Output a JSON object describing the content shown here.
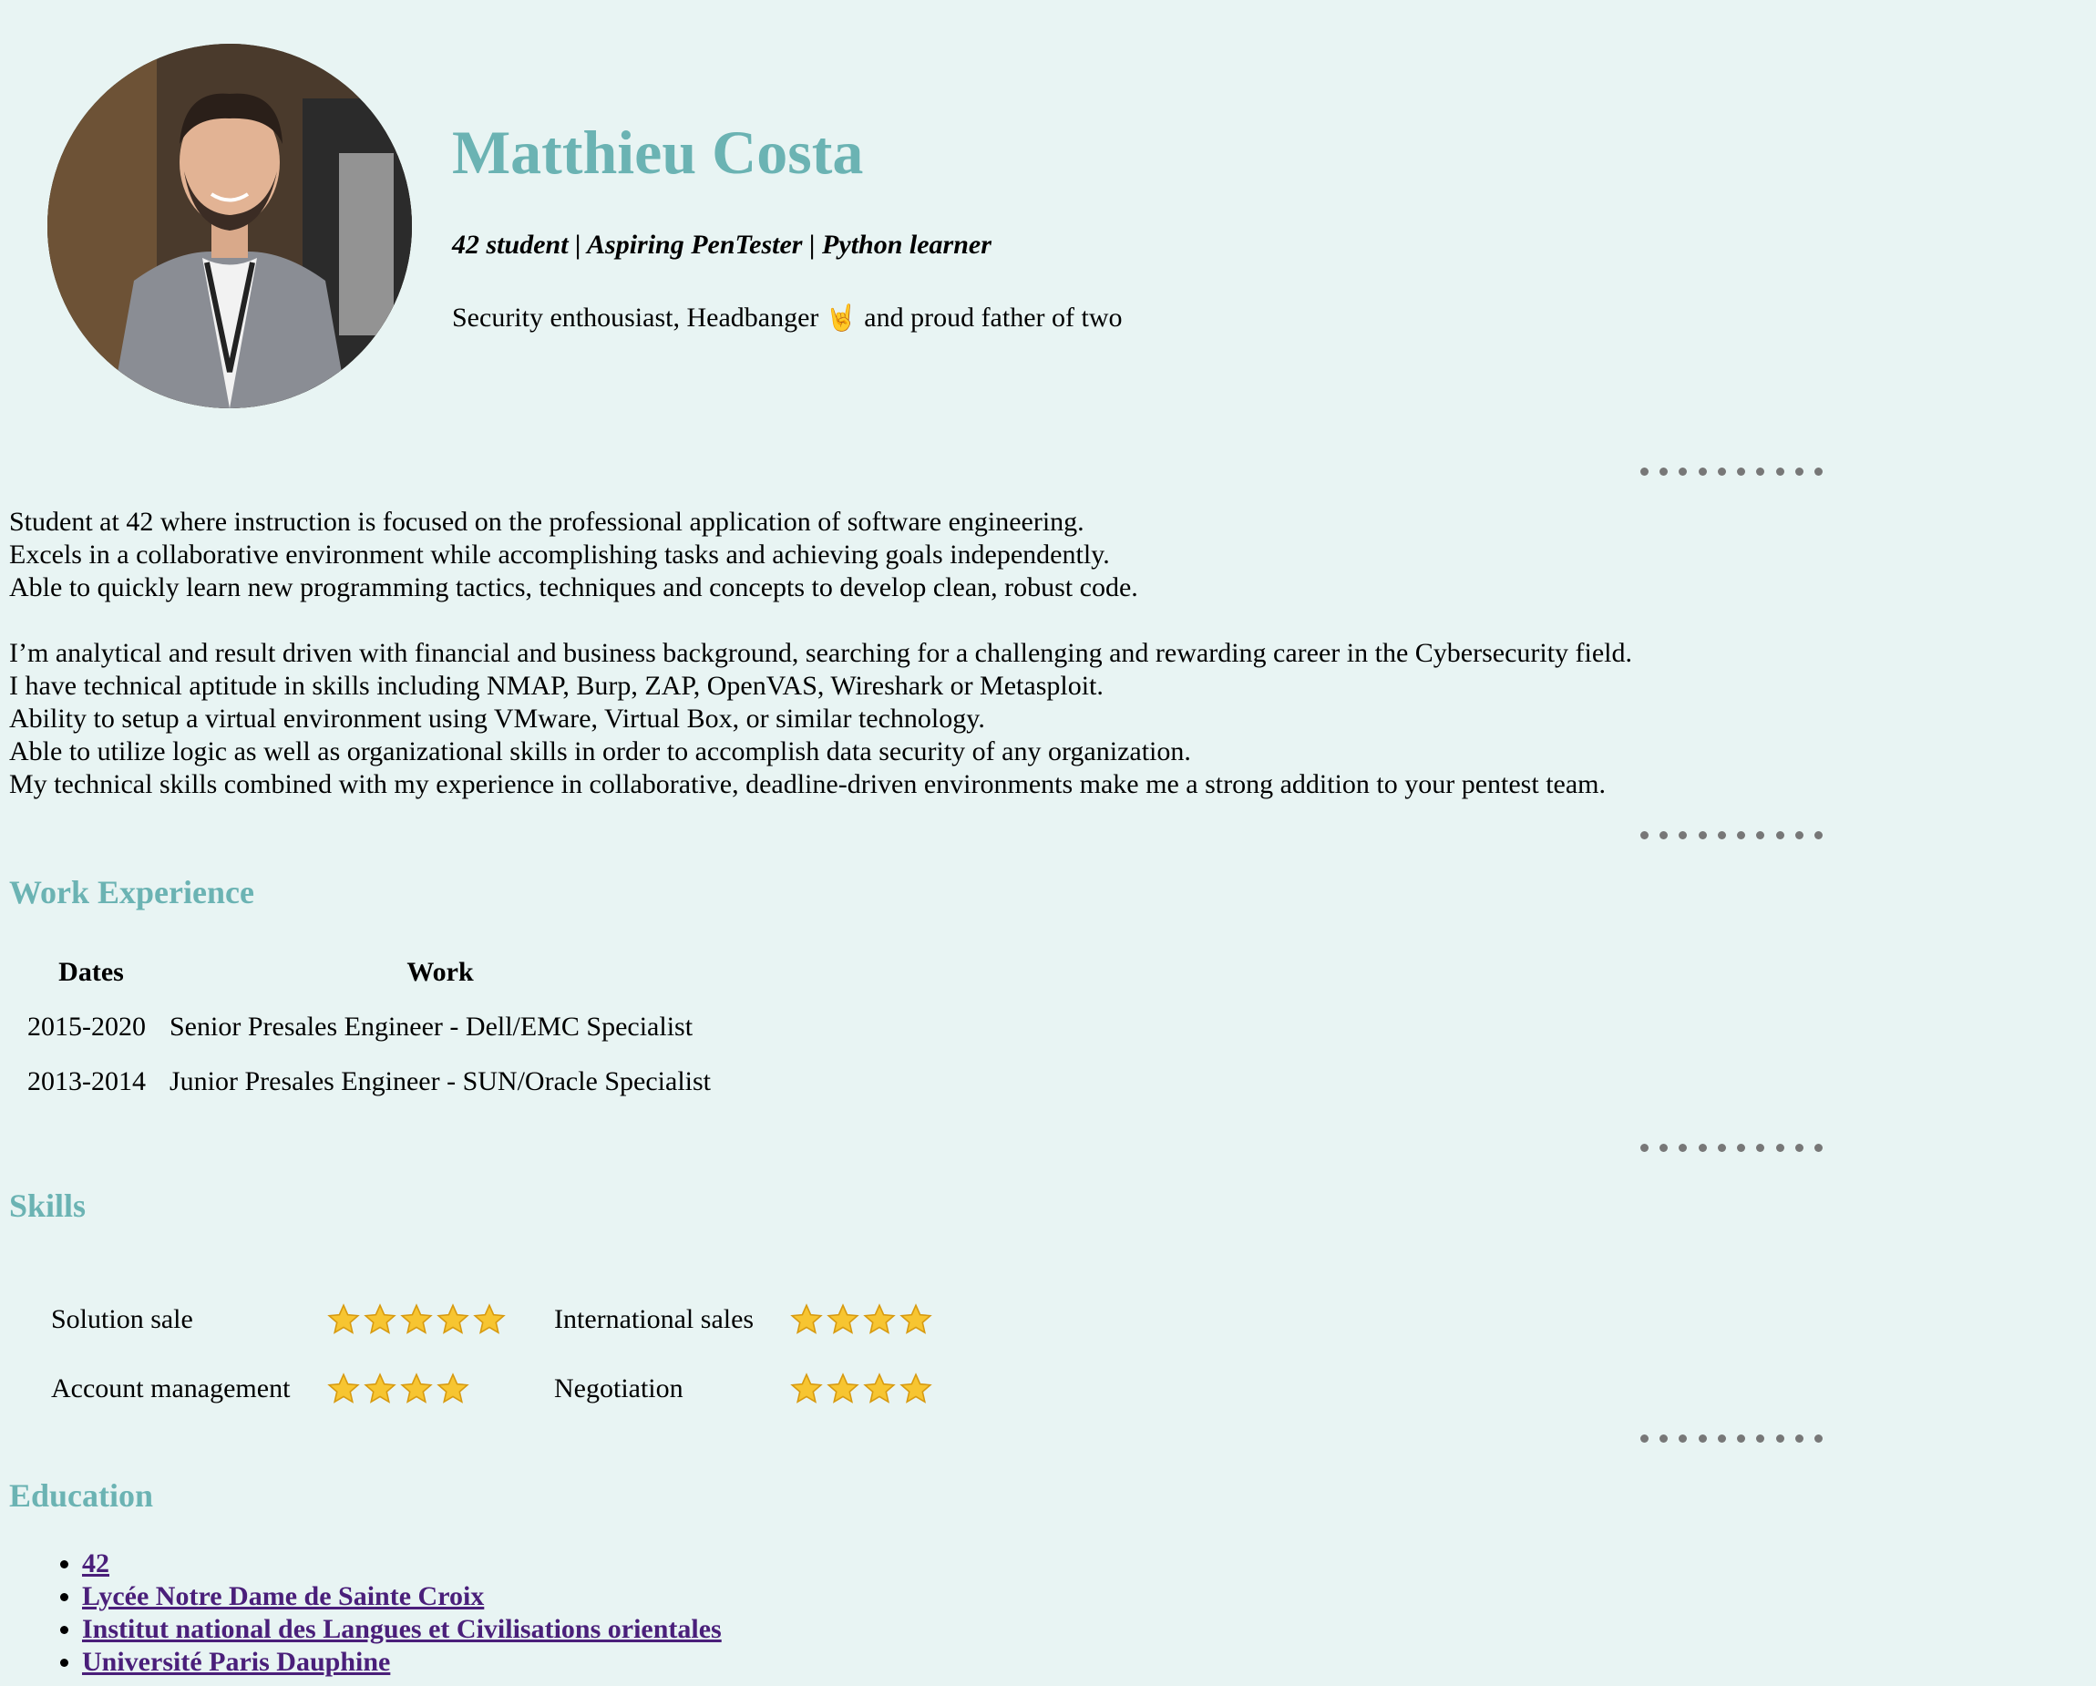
{
  "profile": {
    "name": "Matthieu Costa",
    "tagline": "42 student | Aspiring PenTester | Python learner",
    "bio_before": "Security enthousiast, Headbanger",
    "bio_emoji": "🤘",
    "bio_after": "and proud father of two"
  },
  "about": {
    "paragraph1": [
      "Student at 42 where instruction is focused on the professional application of software engineering.",
      "Excels in a collaborative environment while accomplishing tasks and achieving goals independently.",
      "Able to quickly learn new programming tactics, techniques and concepts to develop clean, robust code."
    ],
    "paragraph2": [
      "I’m analytical and result driven with financial and business background, searching for a challenging and rewarding career in the Cybersecurity field.",
      "I have technical aptitude in skills including NMAP, Burp, ZAP, OpenVAS, Wireshark or Metasploit.",
      "Ability to setup a virtual environment using VMware, Virtual Box, or similar technology.",
      "Able to utilize logic as well as organizational skills in order to accomplish data security of any organization.",
      "My technical skills combined with my experience in collaborative, deadline-driven environments make me a strong addition to your pentest team."
    ]
  },
  "work": {
    "title": "Work Experience",
    "headers": [
      "Dates",
      "Work"
    ],
    "rows": [
      {
        "dates": "2015-2020",
        "work": "Senior Presales Engineer - Dell/EMC Specialist"
      },
      {
        "dates": "2013-2014",
        "work": "Junior Presales Engineer - SUN/Oracle Specialist"
      }
    ]
  },
  "skills": {
    "title": "Skills",
    "rows": [
      {
        "left": {
          "name": "Solution sale",
          "stars": 5
        },
        "right": {
          "name": "International sales",
          "stars": 4
        }
      },
      {
        "left": {
          "name": "Account management",
          "stars": 4
        },
        "right": {
          "name": "Negotiation",
          "stars": 4
        }
      }
    ],
    "star_color": "#f7c531"
  },
  "education": {
    "title": "Education",
    "items": [
      "42",
      "Lycée Notre Dame de Sainte Croix",
      "Institut national des Langues et Civilisations orientales",
      "Université Paris Dauphine"
    ]
  },
  "theme": {
    "background": "#e8f4f3",
    "accent": "#6bb3b3",
    "link": "#4a1f7a",
    "separator_dot": "#777777"
  }
}
